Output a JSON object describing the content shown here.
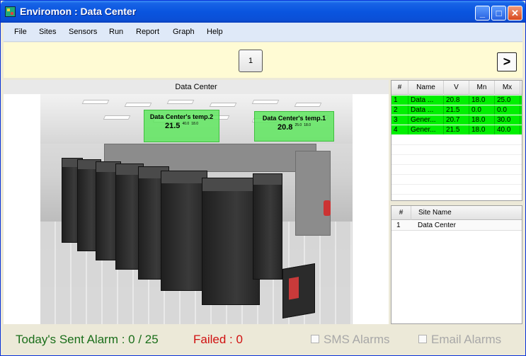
{
  "window": {
    "title": "Enviromon : Data Center",
    "min_label": "_",
    "max_label": "□",
    "close_label": "✕"
  },
  "menu": [
    "File",
    "Sites",
    "Sensors",
    "Run",
    "Report",
    "Graph",
    "Help"
  ],
  "toolbar": {
    "page_label": "1",
    "next_label": ">"
  },
  "main": {
    "header": "Data Center",
    "sensors": [
      {
        "name": "Data Center's temp.2",
        "value": "21.5",
        "max": "40.0",
        "min": "18.0"
      },
      {
        "name": "Data Center's temp.1",
        "value": "20.8",
        "max": "25.0",
        "min": "18.0"
      }
    ]
  },
  "sensor_table": {
    "headers": [
      "#",
      "Name",
      "V",
      "Mn",
      "Mx"
    ],
    "rows": [
      [
        "1",
        "Data ...",
        "20.8",
        "18.0",
        "25.0"
      ],
      [
        "2",
        "Data ...",
        "21.5",
        "0.0",
        "0.0"
      ],
      [
        "3",
        "Gener...",
        "20.7",
        "18.0",
        "30.0"
      ],
      [
        "4",
        "Gener...",
        "21.5",
        "18.0",
        "40.0"
      ]
    ],
    "row_color": "#00f000"
  },
  "site_table": {
    "headers": [
      "#",
      "Site Name"
    ],
    "rows": [
      [
        "1",
        "Data Center"
      ]
    ]
  },
  "status": {
    "sent": "Today's Sent Alarm : 0 / 25",
    "failed": "Failed : 0",
    "sms": "SMS Alarms",
    "email": "Email Alarms",
    "sent_color": "#1a6e1a",
    "failed_color": "#d01010"
  }
}
